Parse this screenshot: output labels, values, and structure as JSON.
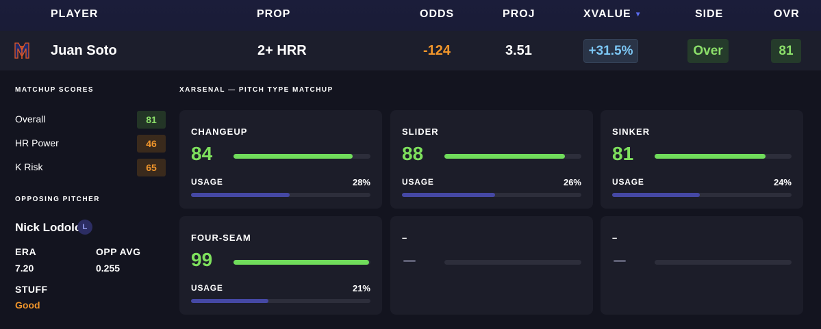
{
  "header": {
    "player": "PLAYER",
    "prop": "PROP",
    "odds": "ODDS",
    "proj": "PROJ",
    "xvalue": "XVALUE",
    "side": "SIDE",
    "ovr": "OVR",
    "sort_icon": "▼"
  },
  "row": {
    "team_logo_icon": "mets-logo-icon",
    "player": "Juan Soto",
    "prop": "2+ HRR",
    "odds": "-124",
    "proj": "3.51",
    "xvalue": "+31.5%",
    "side": "Over",
    "ovr": "81"
  },
  "matchup_scores": {
    "title": "MATCHUP SCORES",
    "items": [
      {
        "label": "Overall",
        "value": "81",
        "status": "good"
      },
      {
        "label": "HR Power",
        "value": "46",
        "status": "warn"
      },
      {
        "label": "K Risk",
        "value": "65",
        "status": "warn"
      }
    ]
  },
  "opposing_pitcher": {
    "title": "OPPOSING PITCHER",
    "name": "Nick Lodolo",
    "hand": "L",
    "era_label": "ERA",
    "era": "7.20",
    "opp_avg_label": "OPP AVG",
    "opp_avg": "0.255",
    "stuff_label": "STUFF",
    "stuff": "Good"
  },
  "xarsenal": {
    "title": "XARSENAL — PITCH TYPE MATCHUP",
    "usage_label": "USAGE",
    "cards": [
      {
        "name": "CHANGEUP",
        "score": "84",
        "score_fraction": 0.87,
        "usage": "28%",
        "usage_fraction": 0.55
      },
      {
        "name": "SLIDER",
        "score": "88",
        "score_fraction": 0.88,
        "usage": "26%",
        "usage_fraction": 0.52
      },
      {
        "name": "SINKER",
        "score": "81",
        "score_fraction": 0.81,
        "usage": "24%",
        "usage_fraction": 0.49
      },
      {
        "name": "FOUR-SEAM",
        "score": "99",
        "score_fraction": 0.99,
        "usage": "21%",
        "usage_fraction": 0.43
      },
      {
        "name": "–",
        "score": null,
        "usage": null
      },
      {
        "name": "–",
        "score": null,
        "usage": null
      }
    ]
  },
  "colors": {
    "accent_green": "#7ee05d",
    "accent_orange": "#f0952b",
    "accent_blue": "#7cc7f5",
    "usage_bar": "#4548a4"
  }
}
